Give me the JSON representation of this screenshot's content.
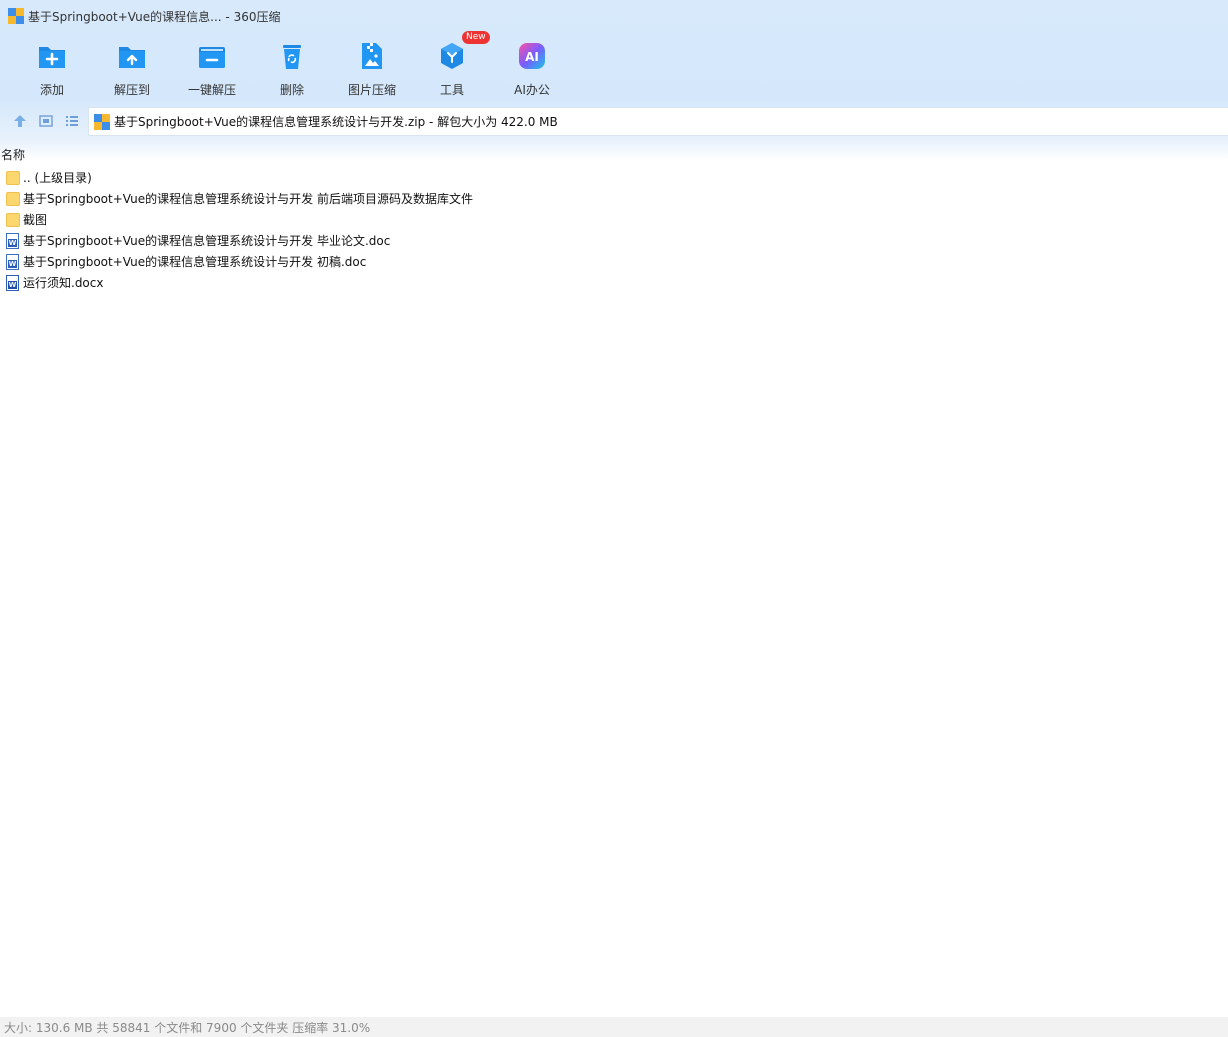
{
  "window": {
    "title": "基于Springboot+Vue的课程信息... - 360压缩"
  },
  "toolbar": {
    "buttons": [
      {
        "label": "添加",
        "icon": "add-icon"
      },
      {
        "label": "解压到",
        "icon": "extract-to-icon"
      },
      {
        "label": "一键解压",
        "icon": "one-click-extract-icon"
      },
      {
        "label": "删除",
        "icon": "delete-icon"
      },
      {
        "label": "图片压缩",
        "icon": "image-compress-icon"
      },
      {
        "label": "工具",
        "icon": "tools-icon",
        "badge": "New"
      },
      {
        "label": "AI办公",
        "icon": "ai-office-icon"
      }
    ]
  },
  "address": {
    "text": "基于Springboot+Vue的课程信息管理系统设计与开发.zip - 解包大小为 422.0 MB"
  },
  "columns": {
    "name": "名称"
  },
  "files": [
    {
      "name": ".. (上级目录)",
      "type": "folder"
    },
    {
      "name": "基于Springboot+Vue的课程信息管理系统设计与开发 前后端项目源码及数据库文件",
      "type": "folder"
    },
    {
      "name": "截图",
      "type": "folder"
    },
    {
      "name": "基于Springboot+Vue的课程信息管理系统设计与开发 毕业论文.doc",
      "type": "doc"
    },
    {
      "name": "基于Springboot+Vue的课程信息管理系统设计与开发 初稿.doc",
      "type": "doc"
    },
    {
      "name": "运行须知.docx",
      "type": "docx"
    }
  ],
  "status": {
    "text": "大小: 130.6 MB 共 58841 个文件和 7900 个文件夹 压缩率 31.0%"
  },
  "colors": {
    "accent": "#1e88e5",
    "toolbar_bg": "#d7e9fb",
    "folder": "#fcd770"
  }
}
